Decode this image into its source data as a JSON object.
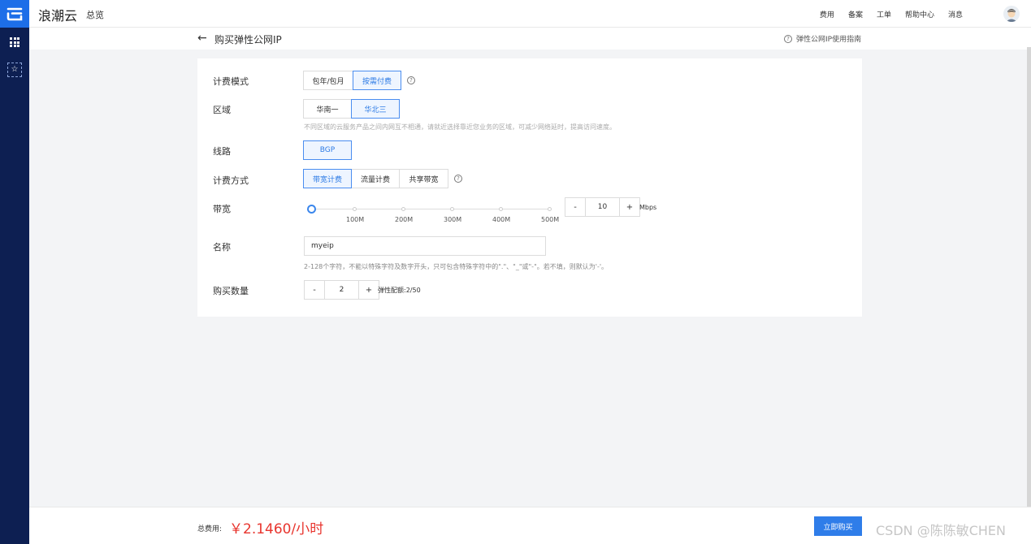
{
  "brand": {
    "name": "浪潮云",
    "overview": "总览"
  },
  "topnav": [
    "费用",
    "备案",
    "工单",
    "帮助中心",
    "消息"
  ],
  "header": {
    "title": "购买弹性公网IP",
    "guide": "弹性公网IP使用指南"
  },
  "form": {
    "billing_mode": {
      "label": "计费模式",
      "options": [
        "包年/包月",
        "按需付费"
      ],
      "selected": "按需付费"
    },
    "region": {
      "label": "区域",
      "options": [
        "华南一",
        "华北三"
      ],
      "selected": "华北三",
      "hint": "不同区域的云服务产品之间内网互不相通，请就近选择靠近您业务的区域，可减少网络延时，提高访问速度。"
    },
    "line": {
      "label": "线路",
      "options": [
        "BGP"
      ],
      "selected": "BGP"
    },
    "charge_type": {
      "label": "计费方式",
      "options": [
        "带宽计费",
        "流量计费",
        "共享带宽"
      ],
      "selected": "带宽计费"
    },
    "bandwidth": {
      "label": "带宽",
      "ticks": [
        "100M",
        "200M",
        "300M",
        "400M",
        "500M"
      ],
      "minus": "-",
      "value": "10",
      "plus": "+",
      "unit": "Mbps",
      "slider_fraction": 0.02
    },
    "name": {
      "label": "名称",
      "value": "myeip",
      "hint": "2-128个字符，不能以特殊字符及数字开头，只可包含特殊字符中的\".\"、\"_\"或\"-\"。若不填，则默认为'-'。"
    },
    "quantity": {
      "label": "购买数量",
      "minus": "-",
      "value": "2",
      "plus": "+",
      "quota": "弹性配额:2/50"
    }
  },
  "footer": {
    "total_label": "总费用:",
    "price": "￥2.1460/小时",
    "buy_label": "立即购买"
  },
  "watermark": "CSDN @陈陈敏CHEN",
  "colors": {
    "rail": "#0d1f52",
    "accent": "#2f7de9",
    "price": "#e8352e"
  }
}
